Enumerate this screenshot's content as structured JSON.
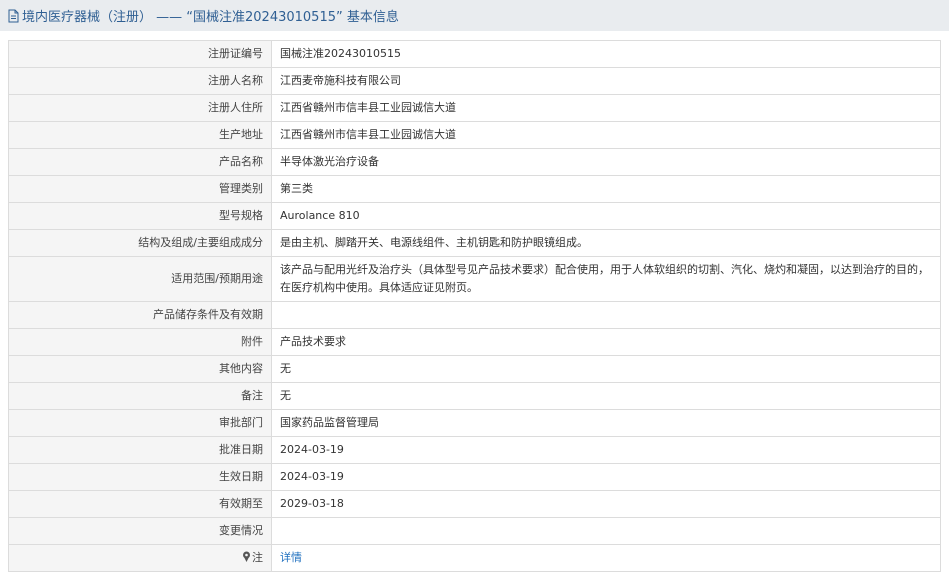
{
  "header": {
    "icon": "document-icon",
    "title": "境内医疗器械（注册） —— “国械注准20243010515” 基本信息"
  },
  "rows": [
    {
      "label": "注册证编号",
      "value": "国械注准20243010515"
    },
    {
      "label": "注册人名称",
      "value": "江西麦帝施科技有限公司"
    },
    {
      "label": "注册人住所",
      "value": "江西省赣州市信丰县工业园诚信大道"
    },
    {
      "label": "生产地址",
      "value": "江西省赣州市信丰县工业园诚信大道"
    },
    {
      "label": "产品名称",
      "value": "半导体激光治疗设备"
    },
    {
      "label": "管理类别",
      "value": "第三类"
    },
    {
      "label": "型号规格",
      "value": "Aurolance 810"
    },
    {
      "label": "结构及组成/主要组成成分",
      "value": "是由主机、脚踏开关、电源线组件、主机钥匙和防护眼镜组成。"
    },
    {
      "label": "适用范围/预期用途",
      "value": "该产品与配用光纤及治疗头（具体型号见产品技术要求）配合使用，用于人体软组织的切割、汽化、烧灼和凝固，以达到治疗的目的，在医疗机构中使用。具体适应证见附页。"
    },
    {
      "label": "产品储存条件及有效期",
      "value": ""
    },
    {
      "label": "附件",
      "value": "产品技术要求"
    },
    {
      "label": "其他内容",
      "value": "无"
    },
    {
      "label": "备注",
      "value": "无"
    },
    {
      "label": "审批部门",
      "value": "国家药品监督管理局"
    },
    {
      "label": "批准日期",
      "value": "2024-03-19"
    },
    {
      "label": "生效日期",
      "value": "2024-03-19"
    },
    {
      "label": "有效期至",
      "value": "2029-03-18"
    },
    {
      "label": "变更情况",
      "value": ""
    }
  ],
  "note": {
    "icon": "pin-icon",
    "label": "注",
    "link": "详情"
  }
}
